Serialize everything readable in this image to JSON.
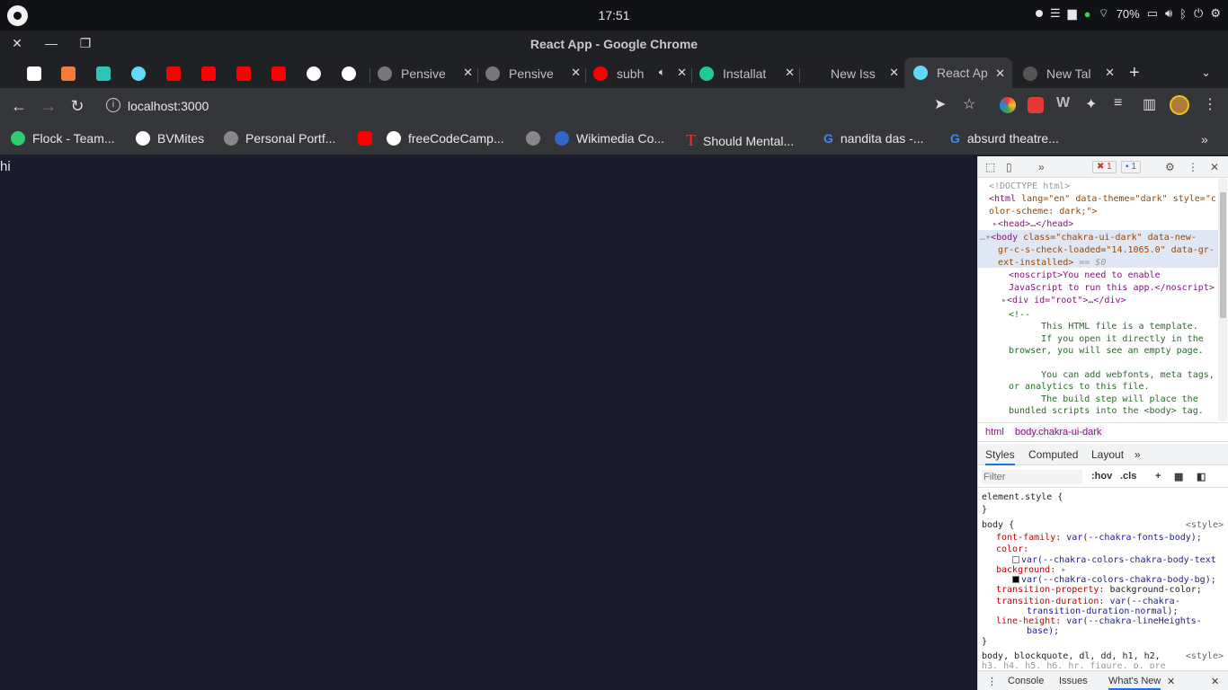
{
  "system": {
    "clock": "17:51",
    "battery": "70%"
  },
  "window": {
    "title": "React App - Google Chrome"
  },
  "tabs": [
    {
      "label": "",
      "color": "#ffffff"
    },
    {
      "label": "",
      "color": "#f47b3a"
    },
    {
      "label": "",
      "color": "#2ec4b6"
    },
    {
      "label": "",
      "color": "#61dafb"
    },
    {
      "label": "",
      "color": "#ff0000"
    },
    {
      "label": "",
      "color": "#ff0000"
    },
    {
      "label": "",
      "color": "#ff0000"
    },
    {
      "label": "",
      "color": "#ff0000"
    },
    {
      "label": "",
      "color": "#ffffff"
    },
    {
      "label": "",
      "color": "#ffffff"
    },
    {
      "label": "Pensive",
      "color": "#777777"
    },
    {
      "label": "Pensive",
      "color": "#777777"
    },
    {
      "label": "subh",
      "color": "#ff0000"
    },
    {
      "label": "Installat",
      "color": "#20c997"
    },
    {
      "label": "New Iss",
      "color": "#202124"
    },
    {
      "label": "React Ap",
      "color": "#61dafb"
    },
    {
      "label": "New Tal",
      "color": "#555555"
    }
  ],
  "toolbar": {
    "url": "localhost:3000"
  },
  "bookmarks": [
    {
      "label": "Flock - Team...",
      "color": "#2ecc71"
    },
    {
      "label": "BVMites",
      "color": "#ffffff"
    },
    {
      "label": "Personal Portf...",
      "color": "#888888"
    },
    {
      "label": "",
      "color": "#ff0000"
    },
    {
      "label": "freeCodeCamp...",
      "color": "#ffffff"
    },
    {
      "label": "",
      "color": "#888888"
    },
    {
      "label": "Wikimedia Co...",
      "color": "#3366cc"
    },
    {
      "label": "Should Mental...",
      "color": "#e53935"
    },
    {
      "label": "nandita das -...",
      "color": "#4285f4"
    },
    {
      "label": "absurd theatre...",
      "color": "#4285f4"
    }
  ],
  "page": {
    "text": "hi"
  },
  "devtools": {
    "errors": "1",
    "messages": "1",
    "crumb_html": "html",
    "crumb_body": "body.chakra-ui-dark",
    "style_tabs": [
      "Styles",
      "Computed",
      "Layout"
    ],
    "filter_placeholder": "Filter",
    "hov": ":hov",
    "cls": ".cls",
    "drawer_tabs": [
      "Console",
      "Issues",
      "What's New"
    ],
    "dom": {
      "doctype": "<!DOCTYPE html>",
      "html_open": "<html",
      "html_attrs": " lang=\"en\" data-theme=\"dark\" style=\"c",
      "html_attrs2": "olor-scheme: dark;\">",
      "head": "<head>…</head>",
      "body1": "<body",
      "body1_attrs": " class=\"chakra-ui-dark\" data-new-",
      "body2": "gr-c-s-check-loaded=\"14.1065.0\" data-gr-",
      "body3": "ext-installed>",
      "body3_eq": " == $0",
      "noscript1": "<noscript>You need to enable",
      "noscript2": "JavaScript to run this app.</noscript>",
      "divroot": "<div id=\"root\">…</div>",
      "comment_open": "<!--",
      "c1": "      This HTML file is a template.",
      "c2": "      If you open it directly in the",
      "c3": "browser, you will see an empty page.",
      "c4": "      You can add webfonts, meta tags,",
      "c5": "or analytics to this file.",
      "c6": "      The build step will place the",
      "c7": "bundled scripts into the <body> tag."
    },
    "styles": {
      "element_style": "element.style {",
      "close": "}",
      "body_sel": "body {",
      "source": "<style>",
      "ff_prop": "font-family:",
      "ff_val": "var(--chakra-fonts-body);",
      "color_prop": "color:",
      "color_val": "var(--chakra-colors-chakra-body-text",
      "bg_prop": "background:",
      "bg_val": "var(--chakra-colors-chakra-body-bg);",
      "tp_prop": "transition-property:",
      "tp_val": "background-color;",
      "td_prop": "transition-duration:",
      "td_val1": "var(--chakra-",
      "td_val2": "transition-duration-normal);",
      "lh_prop": "line-height:",
      "lh_val1": "var(--chakra-lineHeights-",
      "lh_val2": "base);",
      "next_sel1": "body, blockquote, dl, dd, h1, h2,",
      "next_sel2": "h3, h4, h5, h6, hr, figure, p, pre"
    }
  }
}
